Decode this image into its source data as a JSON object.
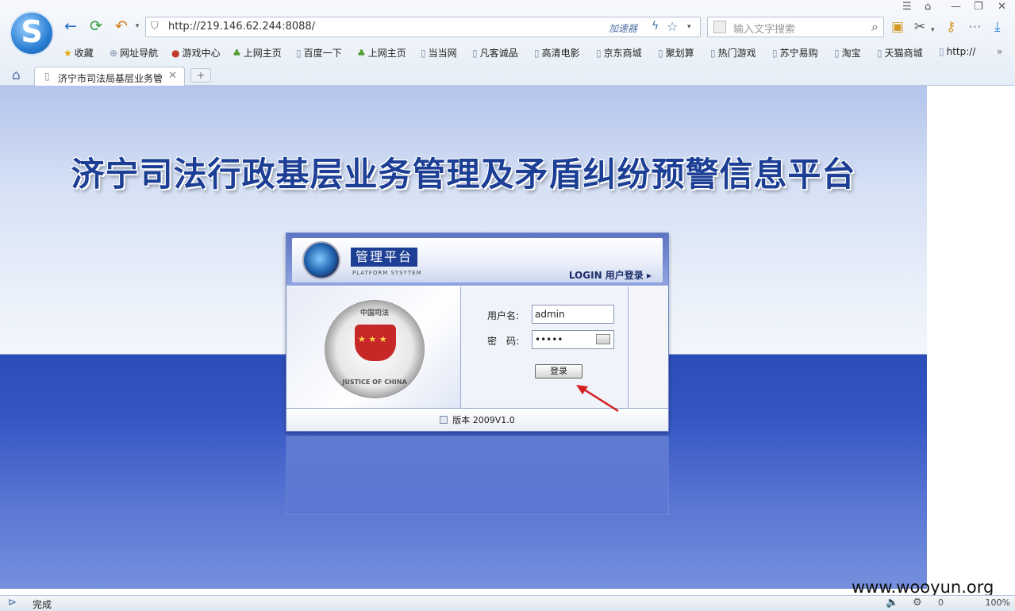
{
  "browser": {
    "url": "http://219.146.62.244:8088/",
    "accelerator_label": "加速器",
    "search_placeholder": "输入文字搜索",
    "bookmarks": [
      "收藏",
      "网址导航",
      "游戏中心",
      "上网主页",
      "百度一下",
      "上网主页",
      "当当网",
      "凡客诚品",
      "高清电影",
      "京东商城",
      "聚划算",
      "热门游戏",
      "苏宁易购",
      "淘宝",
      "天猫商城",
      "http://"
    ],
    "tab_title": "济宁市司法局基层业务管",
    "status_text": "完成",
    "status_count": "0",
    "zoom": "100%",
    "accent_color": "#2a7fd4"
  },
  "page": {
    "headline": "济宁司法行政基层业务管理及矛盾纠纷预警信息平台",
    "panel_title": "管理平台",
    "panel_subtitle": "PLATFORM SYSYTEM",
    "login_title": "LOGIN 用户登录 ▸",
    "emblem_top": "中国司法",
    "emblem_bottom": "JUSTICE OF CHINA",
    "username_label": "用户名:",
    "username_value": "admin",
    "password_label": "密　码:",
    "password_value": "•••••",
    "login_button": "登录",
    "version": "版本 2009V1.0"
  },
  "watermark": "www.wooyun.org"
}
